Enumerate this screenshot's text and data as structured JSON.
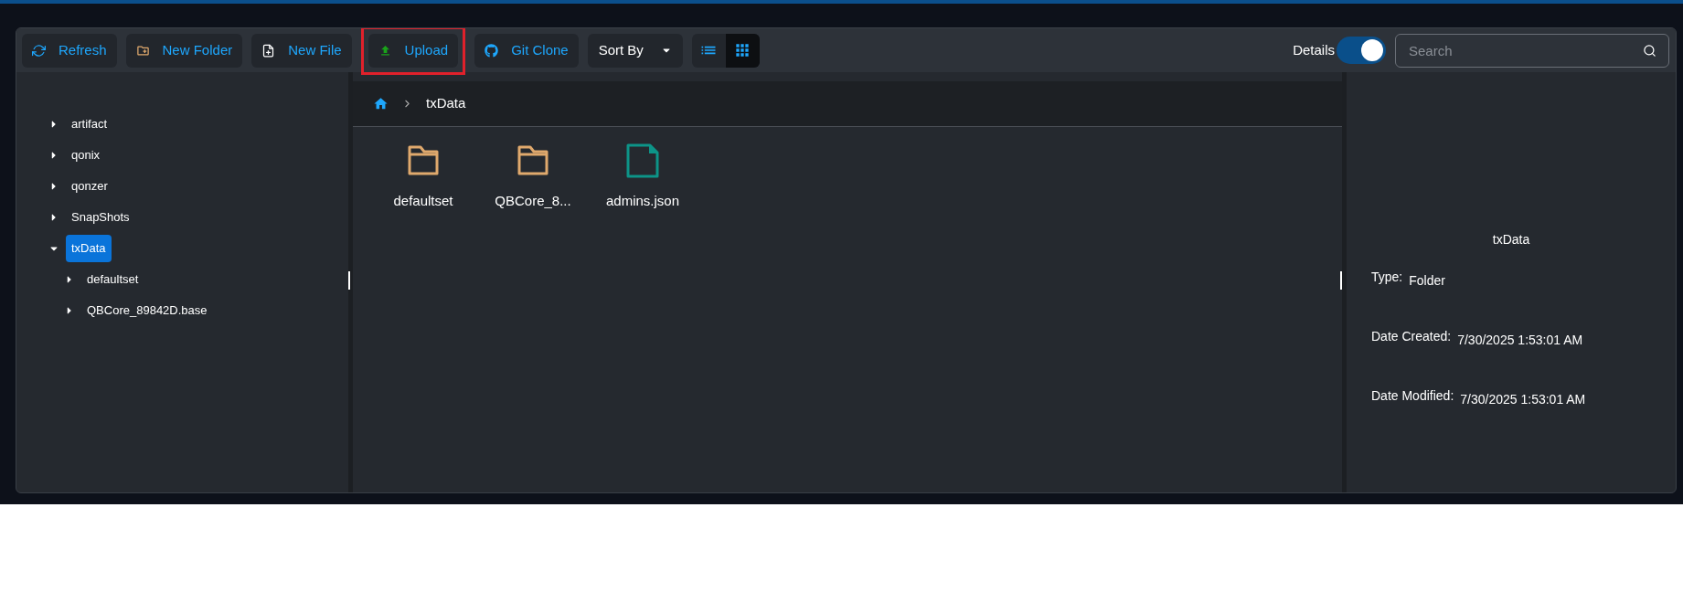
{
  "toolbar": {
    "buttons": [
      {
        "kind": "refresh",
        "label": "Refresh",
        "highlighted": false
      },
      {
        "kind": "new-folder",
        "label": "New Folder",
        "highlighted": false
      },
      {
        "kind": "new-file",
        "label": "New File",
        "highlighted": false
      },
      {
        "kind": "upload",
        "label": "Upload",
        "highlighted": true
      },
      {
        "kind": "git-clone",
        "label": "Git Clone",
        "highlighted": false
      }
    ],
    "sort": {
      "label": "Sort By"
    },
    "views": [
      {
        "kind": "list",
        "selected": false
      },
      {
        "kind": "grid",
        "selected": true
      }
    ],
    "details_toggle": {
      "label": "Details",
      "on": true
    },
    "search": {
      "placeholder": "Search"
    }
  },
  "tree": [
    {
      "label": "artifact",
      "expanded": false,
      "selected": false
    },
    {
      "label": "qonix",
      "expanded": false,
      "selected": false
    },
    {
      "label": "qonzer",
      "expanded": false,
      "selected": false
    },
    {
      "label": "SnapShots",
      "expanded": false,
      "selected": false
    },
    {
      "label": "txData",
      "expanded": true,
      "selected": true,
      "children": [
        {
          "label": "defaultset",
          "expanded": false,
          "selected": false
        },
        {
          "label": "QBCore_89842D.base",
          "expanded": false,
          "selected": false
        }
      ]
    }
  ],
  "breadcrumb": [
    "txData"
  ],
  "files": [
    {
      "kind": "folder",
      "name": "defaultset"
    },
    {
      "kind": "folder",
      "name": "QBCore_8..."
    },
    {
      "kind": "file",
      "name": "admins.json"
    }
  ],
  "details": {
    "title": "txData",
    "fields": [
      {
        "label": "Type:",
        "value": "Folder"
      },
      {
        "label": "Date Created:",
        "value": "7/30/2025 1:53:01 AM"
      },
      {
        "label": "Date Modified:",
        "value": "7/30/2025 1:53:01 AM"
      }
    ]
  }
}
